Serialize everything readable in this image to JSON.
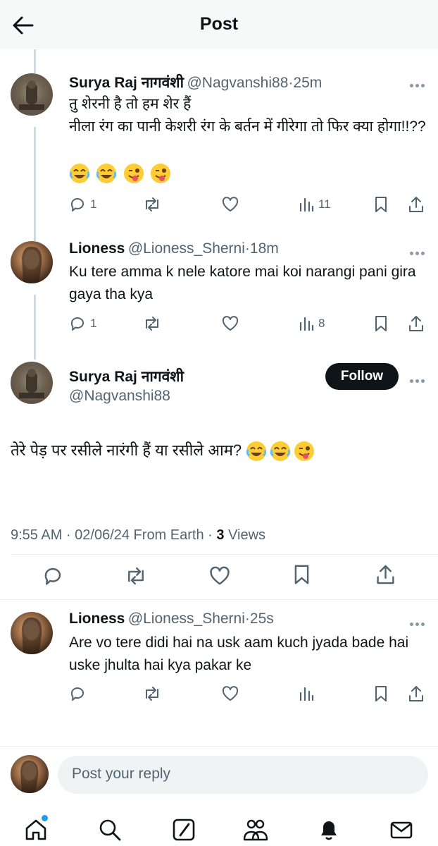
{
  "header": {
    "title": "Post"
  },
  "thread": [
    {
      "name": "Surya Raj नागवंशी",
      "handle": "@Nagvanshi88",
      "sep": "·",
      "time": "25m",
      "text": "तु शेरनी है तो हम शेर हैं\nनीला रंग का पानी केशरी रंग के बर्तन में गीरेगा तो फिर क्या होगा!!??",
      "emojis": [
        "joy",
        "joy",
        "wink-tongue",
        "wink-tongue"
      ],
      "replies": "1",
      "views": "11"
    },
    {
      "name": "Lioness",
      "handle": "@Lioness_Sherni",
      "sep": "·",
      "time": "18m",
      "text": "Ku tere amma k nele katore mai koi narangi pani gira gaya tha kya",
      "replies": "1",
      "views": "8"
    }
  ],
  "main": {
    "name": "Surya Raj नागवंशी",
    "handle": "@Nagvanshi88",
    "follow_label": "Follow",
    "text": "तेरे पेड़ पर रसीले नारंगी हैं या रसीले आम?",
    "emojis": [
      "joy",
      "joy",
      "wink-tongue"
    ],
    "timestamp": "9:55 AM · 02/06/24 From Earth · ",
    "views_count": "3",
    "views_label": " Views"
  },
  "reply": {
    "name": "Lioness",
    "handle": "@Lioness_Sherni",
    "sep": "·",
    "time": "25s",
    "text": "Are vo tere didi hai na usk aam kuch jyada bade hai uske jhulta hai kya pakar ke"
  },
  "composer": {
    "placeholder": "Post your reply"
  },
  "bottom_nav": [
    "home-icon",
    "search-icon",
    "grok-icon",
    "communities-icon",
    "notifications-icon",
    "messages-icon"
  ],
  "colors": {
    "accent": "#1d9bf0",
    "text": "#0f1419",
    "muted": "#536471"
  }
}
